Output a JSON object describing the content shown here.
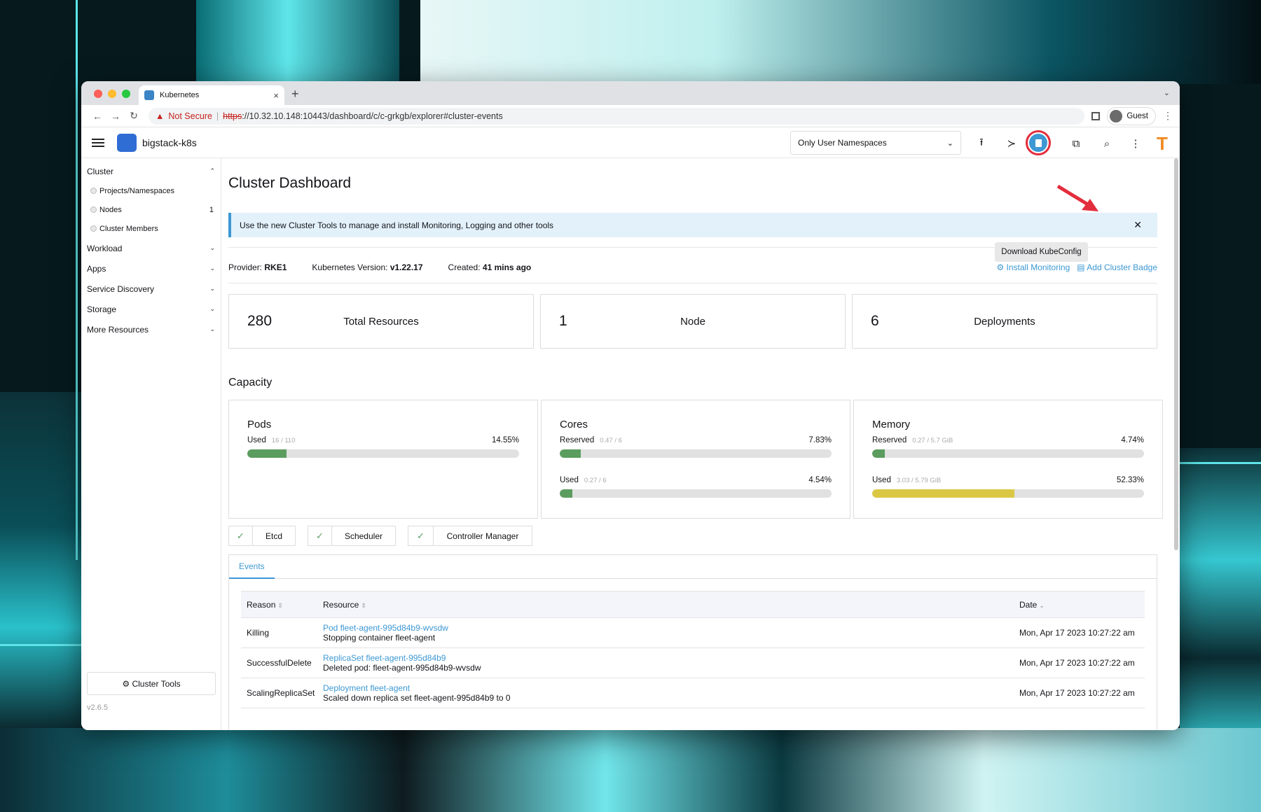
{
  "browser": {
    "tab_title": "Kubernetes",
    "new_tab": "+",
    "close_tab": "×",
    "expand": "⌄",
    "back": "←",
    "forward": "→",
    "reload": "↻",
    "not_secure": "Not Secure",
    "url_scheme": "https",
    "url_rest": "://10.32.10.148:10443/dashboard/c/c-grkgb/explorer#cluster-events",
    "profile": "Guest",
    "menu": "⋮"
  },
  "header": {
    "cluster_name": "bigstack-k8s",
    "namespace_filter": "Only User Namespaces",
    "tooltip": "Download KubeConfig",
    "user_initial": "T",
    "icons": {
      "import": "⭱",
      "shell": "≻",
      "copy": "⧉",
      "search": "⌕",
      "more": "⋮"
    }
  },
  "sidebar": {
    "cluster_label": "Cluster",
    "cluster_items": [
      {
        "label": "Projects/Namespaces",
        "count": ""
      },
      {
        "label": "Nodes",
        "count": "1"
      },
      {
        "label": "Cluster Members",
        "count": ""
      }
    ],
    "groups": [
      "Workload",
      "Apps",
      "Service Discovery",
      "Storage",
      "More Resources"
    ],
    "cluster_tools": "Cluster Tools",
    "version": "v2.6.5"
  },
  "main": {
    "title": "Cluster Dashboard",
    "banner": "Use the new Cluster Tools to manage and install Monitoring, Logging and other tools",
    "meta": {
      "provider_label": "Provider:",
      "provider": "RKE1",
      "k8s_label": "Kubernetes Version:",
      "k8s": "v1.22.17",
      "created_label": "Created:",
      "created": "41 mins ago"
    },
    "install_monitoring": "Install Monitoring",
    "add_badge": "Add Cluster Badge",
    "cards": [
      {
        "num": "280",
        "label": "Total Resources"
      },
      {
        "num": "1",
        "label": "Node"
      },
      {
        "num": "6",
        "label": "Deployments"
      }
    ],
    "capacity_title": "Capacity",
    "pods": {
      "title": "Pods",
      "used_label": "Used",
      "used_sub": "16 / 110",
      "used_pct": "14.55%",
      "used_frac": 0.1455
    },
    "cores": {
      "title": "Cores",
      "reserved_label": "Reserved",
      "reserved_sub": "0.47 / 6",
      "reserved_pct": "7.83%",
      "reserved_frac": 0.0783,
      "used_label": "Used",
      "used_sub": "0.27 / 6",
      "used_pct": "4.54%",
      "used_frac": 0.0454
    },
    "memory": {
      "title": "Memory",
      "reserved_label": "Reserved",
      "reserved_sub": "0.27 / 5.7 GiB",
      "reserved_pct": "4.74%",
      "reserved_frac": 0.0474,
      "used_label": "Used",
      "used_sub": "3.03 / 5.79 GiB",
      "used_pct": "52.33%",
      "used_frac": 0.5233
    },
    "components": [
      "Etcd",
      "Scheduler",
      "Controller Manager"
    ],
    "events_tab": "Events",
    "table": {
      "headers": {
        "reason": "Reason",
        "resource": "Resource",
        "date": "Date"
      },
      "rows": [
        {
          "reason": "Killing",
          "resource": "Pod fleet-agent-995d84b9-wvsdw",
          "message": "Stopping container fleet-agent",
          "date": "Mon, Apr 17 2023  10:27:22 am"
        },
        {
          "reason": "SuccessfulDelete",
          "resource": "ReplicaSet fleet-agent-995d84b9",
          "message": "Deleted pod: fleet-agent-995d84b9-wvsdw",
          "date": "Mon, Apr 17 2023  10:27:22 am"
        },
        {
          "reason": "ScalingReplicaSet",
          "resource": "Deployment fleet-agent",
          "message": "Scaled down replica set fleet-agent-995d84b9 to 0",
          "date": "Mon, Apr 17 2023  10:27:22 am"
        }
      ]
    }
  }
}
